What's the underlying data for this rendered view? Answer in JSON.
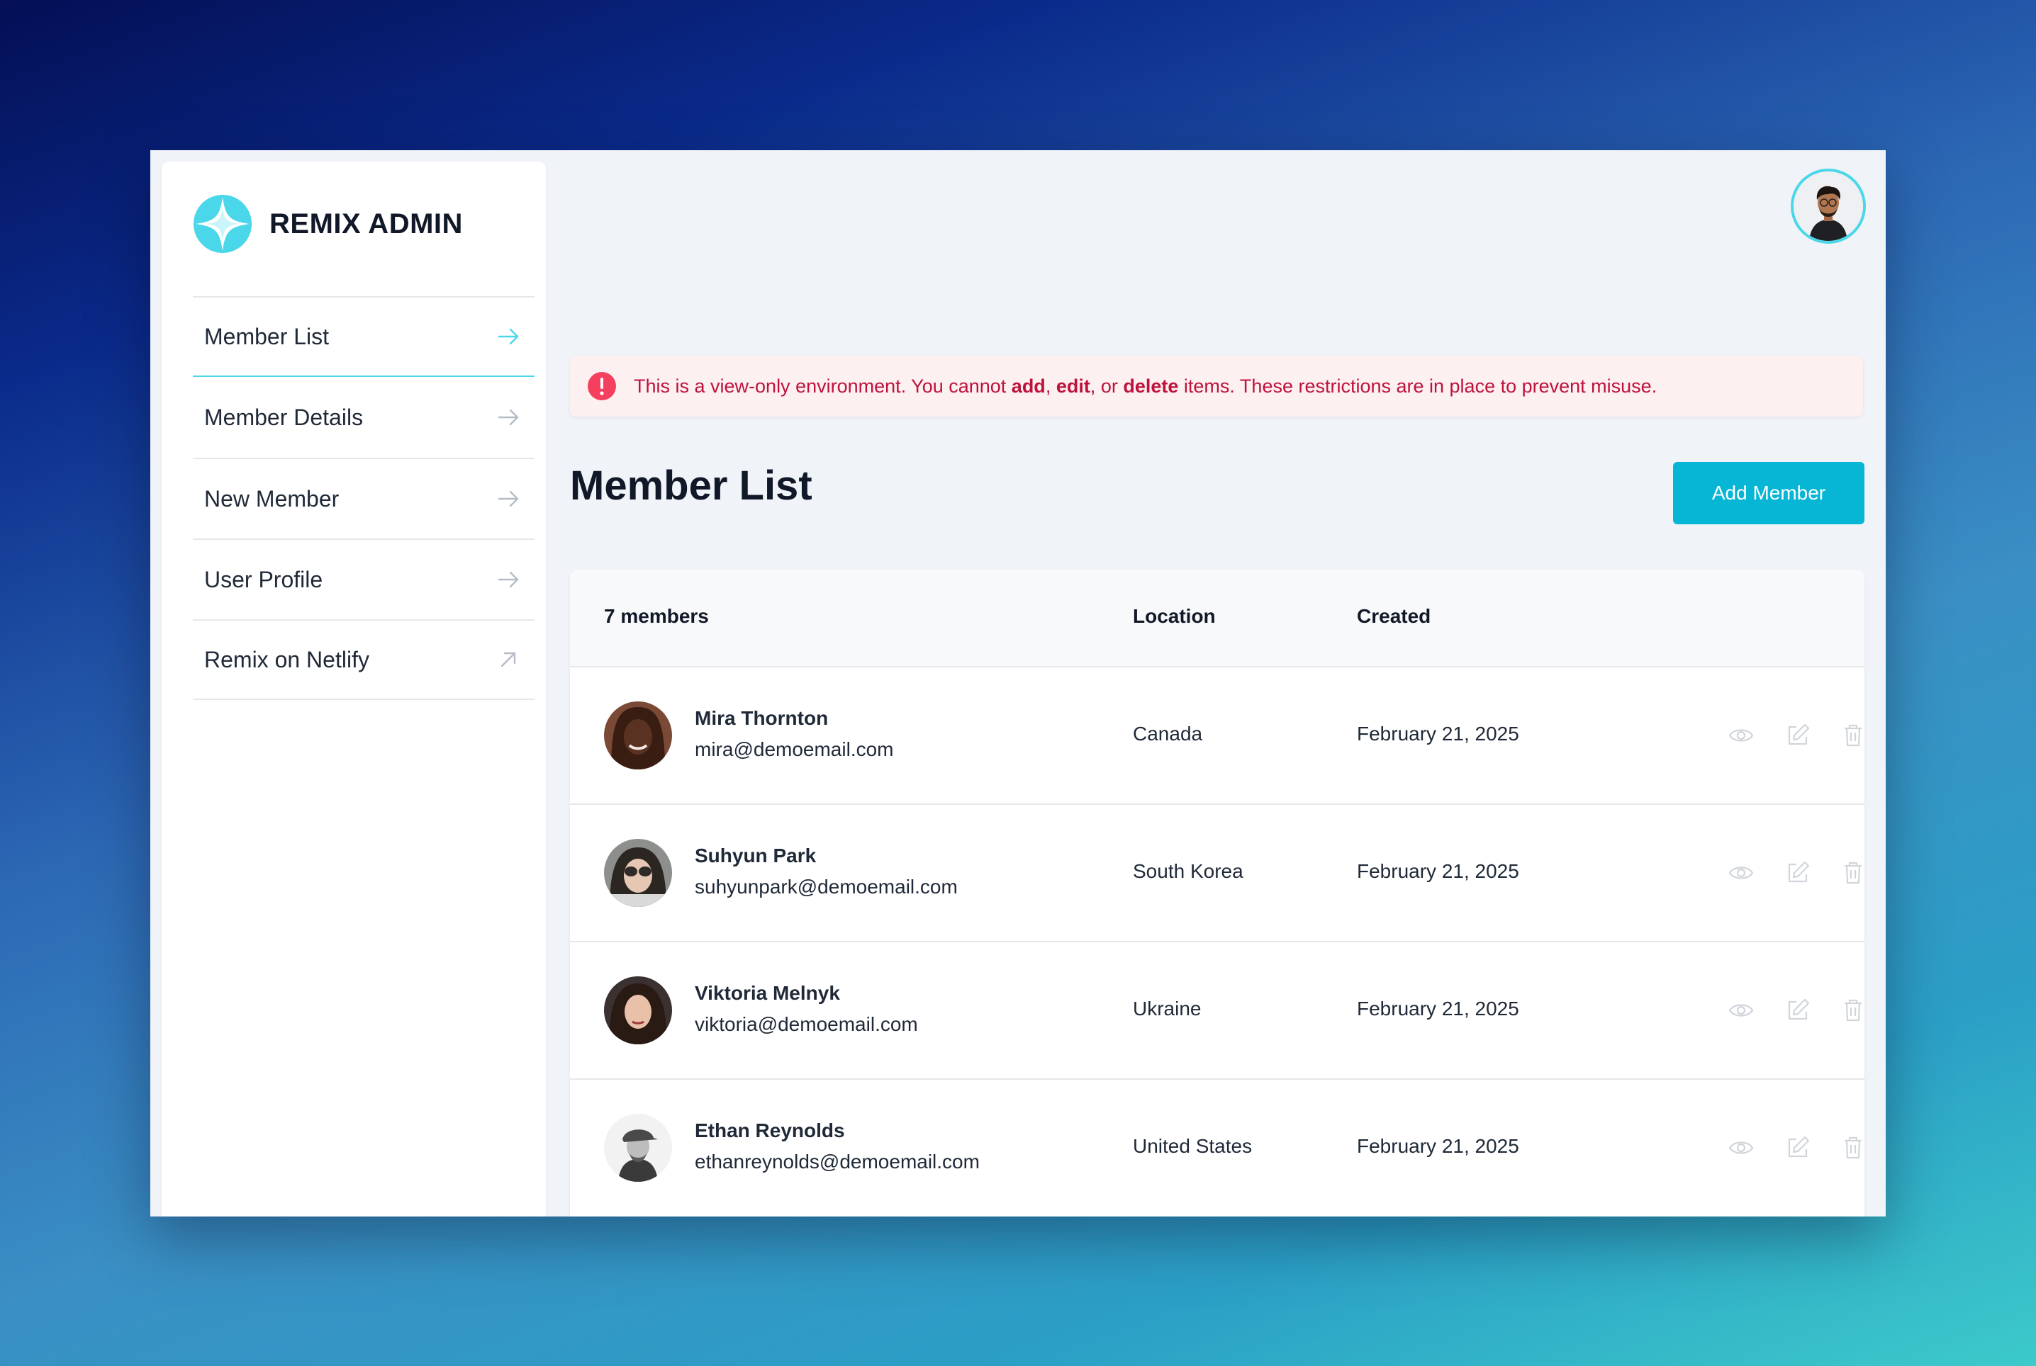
{
  "brand": {
    "name": "REMIX ADMIN",
    "accent": "#4ad7ea"
  },
  "sidebar": {
    "items": [
      {
        "label": "Member List",
        "icon": "arrow-right-icon",
        "active": true
      },
      {
        "label": "Member Details",
        "icon": "arrow-right-icon"
      },
      {
        "label": "New Member",
        "icon": "arrow-right-icon"
      },
      {
        "label": "User Profile",
        "icon": "arrow-right-icon"
      },
      {
        "label": "Remix on Netlify",
        "icon": "external-link-icon"
      }
    ]
  },
  "alert": {
    "prefix": "This is a view-only environment. You cannot ",
    "add": "add",
    "sep1": ", ",
    "edit": "edit",
    "sep2": ", or ",
    "delete": "delete",
    "suffix": " items. These restrictions are in place to prevent misuse.",
    "color": "#be123c"
  },
  "page": {
    "title": "Member List",
    "add_button": "Add Member",
    "button_color": "#06b6d4"
  },
  "table": {
    "headers": {
      "count": "7 members",
      "location": "Location",
      "created": "Created"
    },
    "rows": [
      {
        "name": "Mira Thornton",
        "email": "mira@demoemail.com",
        "location": "Canada",
        "created": "February 21, 2025"
      },
      {
        "name": "Suhyun Park",
        "email": "suhyunpark@demoemail.com",
        "location": "South Korea",
        "created": "February 21, 2025"
      },
      {
        "name": "Viktoria Melnyk",
        "email": "viktoria@demoemail.com",
        "location": "Ukraine",
        "created": "February 21, 2025"
      },
      {
        "name": "Ethan Reynolds",
        "email": "ethanreynolds@demoemail.com",
        "location": "United States",
        "created": "February 21, 2025"
      }
    ]
  }
}
